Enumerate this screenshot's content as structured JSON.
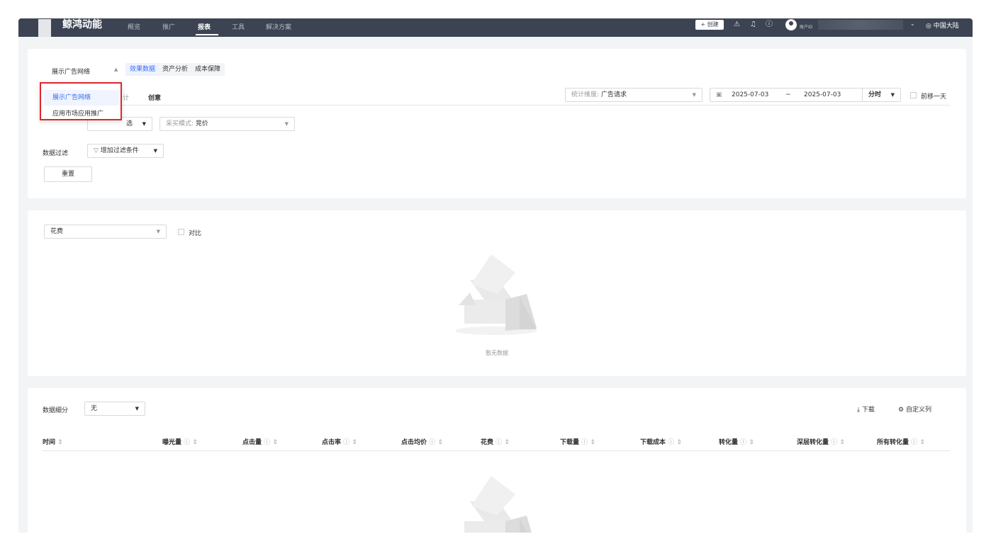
{
  "topbar": {
    "brand": "鲸鸿动能",
    "nav": [
      "概览",
      "推广",
      "报表",
      "工具",
      "解决方案"
    ],
    "create_label": "+ 创建",
    "account_label": "账户ID",
    "region": "◎ 中国大陆"
  },
  "filters": {
    "network_dropdown": "展示广告网络",
    "tabs": [
      "效果数据",
      "资产分析",
      "成本保障"
    ],
    "dimension_tab_hidden": "计",
    "dimension_tab": "创意",
    "stat_dimension_label": "统计维度:",
    "stat_dimension_value": "广告请求",
    "date_start": "2025-07-03",
    "date_sep": "~",
    "date_end": "2025-07-03",
    "granularity": "分时",
    "shift_label": "前移一天",
    "select_suffix": "选",
    "bid_mode_label": "采买模式:",
    "bid_mode_value": "竞价",
    "data_filter_label": "数据过滤",
    "add_filter_label": "增加过滤条件",
    "reset_label": "重置"
  },
  "network_menu": {
    "options": [
      "展示广告网络",
      "应用市场应用推广"
    ],
    "selected": "展示广告网络"
  },
  "chart_panel": {
    "metric_select": "花费",
    "compare_label": "对比",
    "empty_text": "暂无数据"
  },
  "table_panel": {
    "breakdown_label": "数据细分",
    "breakdown_value": "无",
    "download_label": "下载",
    "custom_columns_label": "自定义列",
    "columns": [
      "时间",
      "曝光量",
      "点击量",
      "点击率",
      "点击均价",
      "花费",
      "下载量",
      "下载成本",
      "转化量",
      "深层转化量",
      "所有转化量"
    ]
  },
  "colors": {
    "topbar": "#3c4453",
    "accent": "#3a6df0",
    "highlight_border": "#e0262d"
  }
}
